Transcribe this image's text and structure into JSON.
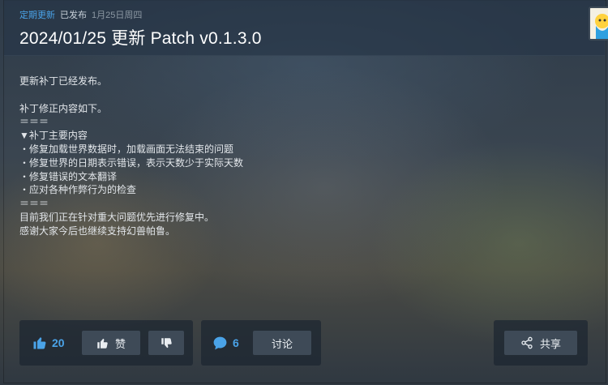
{
  "post": {
    "category": "定期更新",
    "status": "已发布",
    "date": "1月25日周四",
    "title": "2024/01/25 更新 Patch v0.1.3.0",
    "lines": [
      "更新补丁已经发布。",
      "",
      "补丁修正内容如下。",
      "＝＝＝",
      "▼补丁主要内容",
      "・修复加载世界数据时，加载画面无法结束的问题",
      "・修复世界的日期表示错误，表示天数少于实际天数",
      "・修复错误的文本翻译",
      "・应对各种作弊行为的检查",
      "＝＝＝",
      "目前我们正在针对重大问题优先进行修复中。",
      "感谢大家今后也继续支持幻兽帕鲁。"
    ]
  },
  "actions": {
    "like_count": "20",
    "like_label": "赞",
    "comment_count": "6",
    "discuss_label": "讨论",
    "share_label": "共享"
  },
  "colors": {
    "accent": "#4aa3e8",
    "button": "#3e4a57"
  },
  "icons": [
    "thumbs-up-icon",
    "thumbs-down-icon",
    "comment-bubble-icon",
    "share-icon",
    "avatar"
  ]
}
